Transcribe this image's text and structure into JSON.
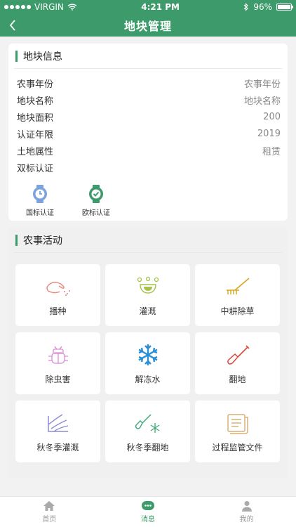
{
  "status_bar": {
    "carrier": "VIRGIN",
    "time": "4:21 PM",
    "battery": "96%"
  },
  "nav": {
    "title": "地块管理"
  },
  "info": {
    "section_title": "地块信息",
    "rows": [
      {
        "key": "农事年份",
        "value": "农事年份"
      },
      {
        "key": "地块名称",
        "value": "地块名称"
      },
      {
        "key": "地块面积",
        "value": "200"
      },
      {
        "key": "认证年限",
        "value": "2019"
      },
      {
        "key": "土地属性",
        "value": "租赁"
      },
      {
        "key": "双标认证",
        "value": ""
      }
    ],
    "certs": [
      {
        "label": "国标认证",
        "icon": "watch-icon",
        "color": "#7aa3e0"
      },
      {
        "label": "欧标认证",
        "icon": "watch-check-icon",
        "color": "#3d9a6a"
      }
    ]
  },
  "activities": {
    "section_title": "农事活动",
    "items": [
      {
        "label": "播种",
        "icon": "sowing-hand-icon",
        "color": "#e8857a"
      },
      {
        "label": "灌溉",
        "icon": "irrigation-bowl-icon",
        "color": "#a6c24a"
      },
      {
        "label": "中耕除草",
        "icon": "rake-icon",
        "color": "#d9a520"
      },
      {
        "label": "除虫害",
        "icon": "bug-icon",
        "color": "#d98ad8"
      },
      {
        "label": "解冻水",
        "icon": "snowflake-icon",
        "color": "#2a8fd6"
      },
      {
        "label": "翻地",
        "icon": "shovel-icon",
        "color": "#d94a3a"
      },
      {
        "label": "秋冬季灌溉",
        "icon": "winter-irrigation-icon",
        "color": "#8a8ad9"
      },
      {
        "label": "秋冬季翻地",
        "icon": "winter-shovel-icon",
        "color": "#3daa7a"
      },
      {
        "label": "过程监管文件",
        "icon": "document-icon",
        "color": "#d9b07a"
      }
    ]
  },
  "tabs": [
    {
      "label": "首页",
      "icon": "home-icon"
    },
    {
      "label": "消息",
      "icon": "message-icon"
    },
    {
      "label": "我的",
      "icon": "user-icon"
    }
  ],
  "colors": {
    "brand": "#3d9a6a"
  }
}
